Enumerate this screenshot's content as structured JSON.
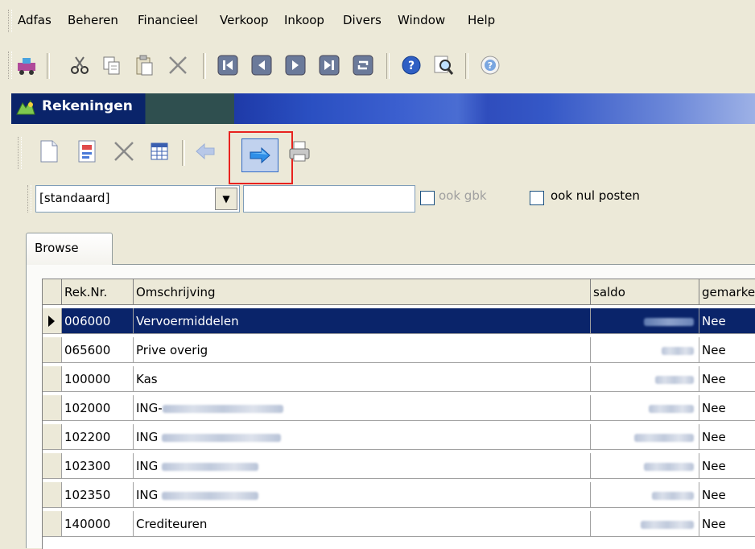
{
  "menu": [
    "Adfas",
    "Beheren",
    "Financieel",
    "Verkoop",
    "Inkoop",
    "Divers",
    "Window",
    "Help"
  ],
  "toolbar_icons": [
    "app-icon",
    "cut-icon",
    "copy-icon",
    "paste-icon",
    "delete-icon",
    "first-record-icon",
    "previous-record-icon",
    "next-record-icon",
    "last-record-icon",
    "refresh-icon",
    "help-icon",
    "search-icon",
    "about-icon"
  ],
  "window": {
    "title": "Rekeningen"
  },
  "inner_toolbar_icons": [
    "new-icon",
    "edit-icon",
    "delete-icon",
    "grid-icon",
    "back-arrow-icon",
    "forward-arrow-icon",
    "print-icon"
  ],
  "filter": {
    "preset_value": "[standaard]",
    "search_value": "",
    "ook_gbk_label": "ook gbk",
    "ook_nul_label": "ook nul posten"
  },
  "tabs": [
    "Browse"
  ],
  "grid": {
    "columns": [
      "Rek.Nr.",
      "Omschrijving",
      "saldo",
      "gemarkeerd"
    ],
    "rows": [
      {
        "nr": "006000",
        "desc": "Vervoermiddelen",
        "saldo": "",
        "mark": "Nee"
      },
      {
        "nr": "065600",
        "desc": "Prive overig",
        "saldo": "",
        "mark": "Nee"
      },
      {
        "nr": "100000",
        "desc": "Kas",
        "saldo": "",
        "mark": "Nee"
      },
      {
        "nr": "102000",
        "desc": "ING-",
        "saldo": "",
        "mark": "Nee"
      },
      {
        "nr": "102200",
        "desc": "ING",
        "saldo": "",
        "mark": "Nee"
      },
      {
        "nr": "102300",
        "desc": "ING",
        "saldo": "",
        "mark": "Nee"
      },
      {
        "nr": "102350",
        "desc": "ING",
        "saldo": "",
        "mark": "Nee"
      },
      {
        "nr": "140000",
        "desc": "Crediteuren",
        "saldo": "",
        "mark": "Nee"
      }
    ]
  },
  "colors": {
    "selection": "#0a246a",
    "highlight_box": "#e8221f",
    "window_bg": "#ece9d8"
  }
}
